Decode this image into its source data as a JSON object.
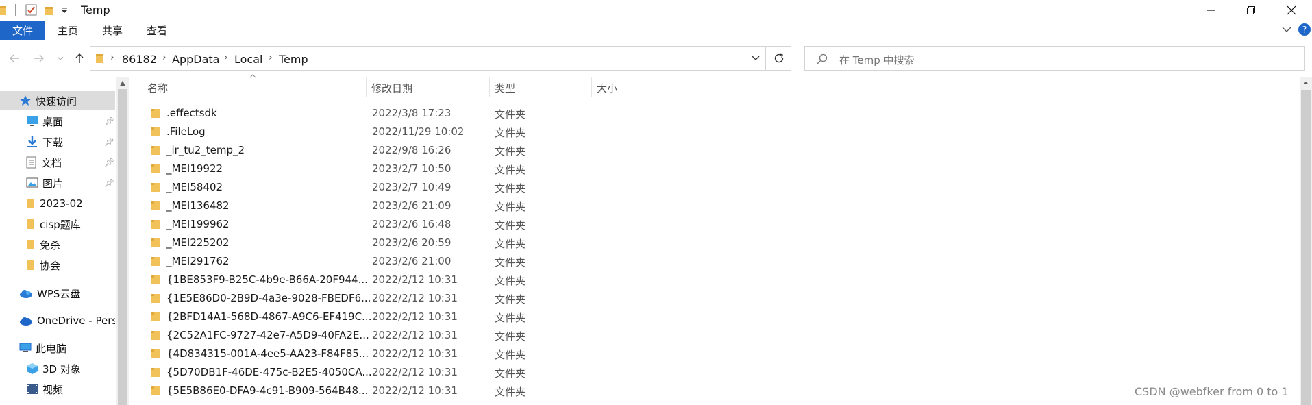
{
  "window": {
    "title": "Temp",
    "controls": {
      "minimize": "minimize-icon",
      "maximize": "restore-icon",
      "close": "close-icon"
    }
  },
  "ribbon": {
    "file_tab": "文件",
    "tabs": [
      "主页",
      "共享",
      "查看"
    ]
  },
  "address": {
    "crumbs": [
      "86182",
      "AppData",
      "Local",
      "Temp"
    ]
  },
  "search": {
    "placeholder": "在 Temp 中搜索"
  },
  "nav": {
    "quick_access": "快速访问",
    "items": [
      {
        "label": "桌面",
        "icon": "desktop-icon",
        "pinned": true
      },
      {
        "label": "下载",
        "icon": "download-icon",
        "pinned": true
      },
      {
        "label": "文档",
        "icon": "document-icon",
        "pinned": true
      },
      {
        "label": "图片",
        "icon": "picture-icon",
        "pinned": true
      },
      {
        "label": "2023-02",
        "icon": "folder-icon",
        "pinned": false
      },
      {
        "label": "cisp题库",
        "icon": "folder-icon",
        "pinned": false
      },
      {
        "label": "免杀",
        "icon": "folder-icon",
        "pinned": false
      },
      {
        "label": "协会",
        "icon": "folder-icon",
        "pinned": false
      }
    ],
    "wps": "WPS云盘",
    "onedrive": "OneDrive - Perso",
    "this_pc": "此电脑",
    "pc_items": [
      {
        "label": "3D 对象",
        "icon": "3d-objects-icon"
      },
      {
        "label": "视频",
        "icon": "video-icon"
      }
    ]
  },
  "columns": {
    "name": "名称",
    "date": "修改日期",
    "type": "类型",
    "size": "大小"
  },
  "files": [
    {
      "name": ".effectsdk",
      "date": "2022/3/8 17:23",
      "type": "文件夹"
    },
    {
      "name": ".FileLog",
      "date": "2022/11/29 10:02",
      "type": "文件夹"
    },
    {
      "name": "_ir_tu2_temp_2",
      "date": "2022/9/8 16:26",
      "type": "文件夹"
    },
    {
      "name": "_MEI19922",
      "date": "2023/2/7 10:50",
      "type": "文件夹"
    },
    {
      "name": "_MEI58402",
      "date": "2023/2/7 10:49",
      "type": "文件夹"
    },
    {
      "name": "_MEI136482",
      "date": "2023/2/6 21:09",
      "type": "文件夹"
    },
    {
      "name": "_MEI199962",
      "date": "2023/2/6 16:48",
      "type": "文件夹"
    },
    {
      "name": "_MEI225202",
      "date": "2023/2/6 20:59",
      "type": "文件夹"
    },
    {
      "name": "_MEI291762",
      "date": "2023/2/6 21:00",
      "type": "文件夹"
    },
    {
      "name": "{1BE853F9-B25C-4b9e-B66A-20F944...",
      "date": "2022/2/12 10:31",
      "type": "文件夹"
    },
    {
      "name": "{1E5E86D0-2B9D-4a3e-9028-FBEDF6...",
      "date": "2022/2/12 10:31",
      "type": "文件夹"
    },
    {
      "name": "{2BFD14A1-568D-4867-A9C6-EF419C...",
      "date": "2022/2/12 10:31",
      "type": "文件夹"
    },
    {
      "name": "{2C52A1FC-9727-42e7-A5D9-40FA2E...",
      "date": "2022/2/12 10:31",
      "type": "文件夹"
    },
    {
      "name": "{4D834315-001A-4ee5-AA23-F84F85...",
      "date": "2022/2/12 10:31",
      "type": "文件夹"
    },
    {
      "name": "{5D70DB1F-46DE-475c-B2E5-4050CA...",
      "date": "2022/2/12 10:31",
      "type": "文件夹"
    },
    {
      "name": "{5E5B86E0-DFA9-4c91-B909-564B48...",
      "date": "2022/2/12 10:31",
      "type": "文件夹"
    }
  ],
  "watermark": "CSDN @webfker from 0 to 1",
  "colors": {
    "accent": "#1f66c9",
    "folder": "#f2c25a",
    "selection": "#dcdcdc"
  }
}
